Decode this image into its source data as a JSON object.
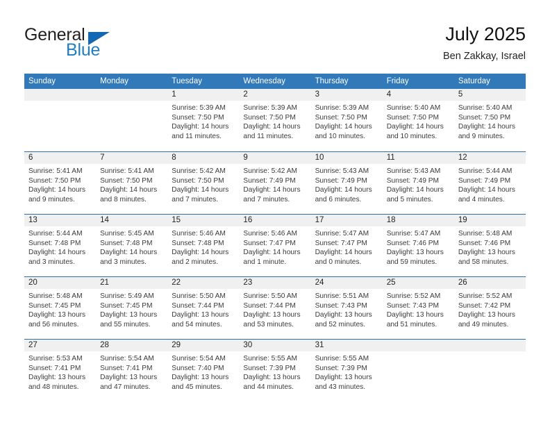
{
  "brand": {
    "name_part1": "General",
    "name_part2": "Blue",
    "accent_color": "#1f7ec4",
    "triangle_color": "#1268b3"
  },
  "header": {
    "title": "July 2025",
    "subtitle": "Ben Zakkay, Israel"
  },
  "calendar": {
    "header_bg": "#3179b8",
    "row_divider_color": "#2f6da8",
    "daynum_bg": "#f0f0f0",
    "weekdays": [
      "Sunday",
      "Monday",
      "Tuesday",
      "Wednesday",
      "Thursday",
      "Friday",
      "Saturday"
    ],
    "weeks": [
      [
        {
          "day": "",
          "sunrise": "",
          "sunset": "",
          "daylight": "",
          "empty": true
        },
        {
          "day": "",
          "sunrise": "",
          "sunset": "",
          "daylight": "",
          "empty": true
        },
        {
          "day": "1",
          "sunrise": "Sunrise: 5:39 AM",
          "sunset": "Sunset: 7:50 PM",
          "daylight": "Daylight: 14 hours and 11 minutes."
        },
        {
          "day": "2",
          "sunrise": "Sunrise: 5:39 AM",
          "sunset": "Sunset: 7:50 PM",
          "daylight": "Daylight: 14 hours and 11 minutes."
        },
        {
          "day": "3",
          "sunrise": "Sunrise: 5:39 AM",
          "sunset": "Sunset: 7:50 PM",
          "daylight": "Daylight: 14 hours and 10 minutes."
        },
        {
          "day": "4",
          "sunrise": "Sunrise: 5:40 AM",
          "sunset": "Sunset: 7:50 PM",
          "daylight": "Daylight: 14 hours and 10 minutes."
        },
        {
          "day": "5",
          "sunrise": "Sunrise: 5:40 AM",
          "sunset": "Sunset: 7:50 PM",
          "daylight": "Daylight: 14 hours and 9 minutes."
        }
      ],
      [
        {
          "day": "6",
          "sunrise": "Sunrise: 5:41 AM",
          "sunset": "Sunset: 7:50 PM",
          "daylight": "Daylight: 14 hours and 9 minutes."
        },
        {
          "day": "7",
          "sunrise": "Sunrise: 5:41 AM",
          "sunset": "Sunset: 7:50 PM",
          "daylight": "Daylight: 14 hours and 8 minutes."
        },
        {
          "day": "8",
          "sunrise": "Sunrise: 5:42 AM",
          "sunset": "Sunset: 7:50 PM",
          "daylight": "Daylight: 14 hours and 7 minutes."
        },
        {
          "day": "9",
          "sunrise": "Sunrise: 5:42 AM",
          "sunset": "Sunset: 7:49 PM",
          "daylight": "Daylight: 14 hours and 7 minutes."
        },
        {
          "day": "10",
          "sunrise": "Sunrise: 5:43 AM",
          "sunset": "Sunset: 7:49 PM",
          "daylight": "Daylight: 14 hours and 6 minutes."
        },
        {
          "day": "11",
          "sunrise": "Sunrise: 5:43 AM",
          "sunset": "Sunset: 7:49 PM",
          "daylight": "Daylight: 14 hours and 5 minutes."
        },
        {
          "day": "12",
          "sunrise": "Sunrise: 5:44 AM",
          "sunset": "Sunset: 7:49 PM",
          "daylight": "Daylight: 14 hours and 4 minutes."
        }
      ],
      [
        {
          "day": "13",
          "sunrise": "Sunrise: 5:44 AM",
          "sunset": "Sunset: 7:48 PM",
          "daylight": "Daylight: 14 hours and 3 minutes."
        },
        {
          "day": "14",
          "sunrise": "Sunrise: 5:45 AM",
          "sunset": "Sunset: 7:48 PM",
          "daylight": "Daylight: 14 hours and 3 minutes."
        },
        {
          "day": "15",
          "sunrise": "Sunrise: 5:46 AM",
          "sunset": "Sunset: 7:48 PM",
          "daylight": "Daylight: 14 hours and 2 minutes."
        },
        {
          "day": "16",
          "sunrise": "Sunrise: 5:46 AM",
          "sunset": "Sunset: 7:47 PM",
          "daylight": "Daylight: 14 hours and 1 minute."
        },
        {
          "day": "17",
          "sunrise": "Sunrise: 5:47 AM",
          "sunset": "Sunset: 7:47 PM",
          "daylight": "Daylight: 14 hours and 0 minutes."
        },
        {
          "day": "18",
          "sunrise": "Sunrise: 5:47 AM",
          "sunset": "Sunset: 7:46 PM",
          "daylight": "Daylight: 13 hours and 59 minutes."
        },
        {
          "day": "19",
          "sunrise": "Sunrise: 5:48 AM",
          "sunset": "Sunset: 7:46 PM",
          "daylight": "Daylight: 13 hours and 58 minutes."
        }
      ],
      [
        {
          "day": "20",
          "sunrise": "Sunrise: 5:48 AM",
          "sunset": "Sunset: 7:45 PM",
          "daylight": "Daylight: 13 hours and 56 minutes."
        },
        {
          "day": "21",
          "sunrise": "Sunrise: 5:49 AM",
          "sunset": "Sunset: 7:45 PM",
          "daylight": "Daylight: 13 hours and 55 minutes."
        },
        {
          "day": "22",
          "sunrise": "Sunrise: 5:50 AM",
          "sunset": "Sunset: 7:44 PM",
          "daylight": "Daylight: 13 hours and 54 minutes."
        },
        {
          "day": "23",
          "sunrise": "Sunrise: 5:50 AM",
          "sunset": "Sunset: 7:44 PM",
          "daylight": "Daylight: 13 hours and 53 minutes."
        },
        {
          "day": "24",
          "sunrise": "Sunrise: 5:51 AM",
          "sunset": "Sunset: 7:43 PM",
          "daylight": "Daylight: 13 hours and 52 minutes."
        },
        {
          "day": "25",
          "sunrise": "Sunrise: 5:52 AM",
          "sunset": "Sunset: 7:43 PM",
          "daylight": "Daylight: 13 hours and 51 minutes."
        },
        {
          "day": "26",
          "sunrise": "Sunrise: 5:52 AM",
          "sunset": "Sunset: 7:42 PM",
          "daylight": "Daylight: 13 hours and 49 minutes."
        }
      ],
      [
        {
          "day": "27",
          "sunrise": "Sunrise: 5:53 AM",
          "sunset": "Sunset: 7:41 PM",
          "daylight": "Daylight: 13 hours and 48 minutes."
        },
        {
          "day": "28",
          "sunrise": "Sunrise: 5:54 AM",
          "sunset": "Sunset: 7:41 PM",
          "daylight": "Daylight: 13 hours and 47 minutes."
        },
        {
          "day": "29",
          "sunrise": "Sunrise: 5:54 AM",
          "sunset": "Sunset: 7:40 PM",
          "daylight": "Daylight: 13 hours and 45 minutes."
        },
        {
          "day": "30",
          "sunrise": "Sunrise: 5:55 AM",
          "sunset": "Sunset: 7:39 PM",
          "daylight": "Daylight: 13 hours and 44 minutes."
        },
        {
          "day": "31",
          "sunrise": "Sunrise: 5:55 AM",
          "sunset": "Sunset: 7:39 PM",
          "daylight": "Daylight: 13 hours and 43 minutes."
        },
        {
          "day": "",
          "sunrise": "",
          "sunset": "",
          "daylight": "",
          "empty": true
        },
        {
          "day": "",
          "sunrise": "",
          "sunset": "",
          "daylight": "",
          "empty": true
        }
      ]
    ]
  }
}
